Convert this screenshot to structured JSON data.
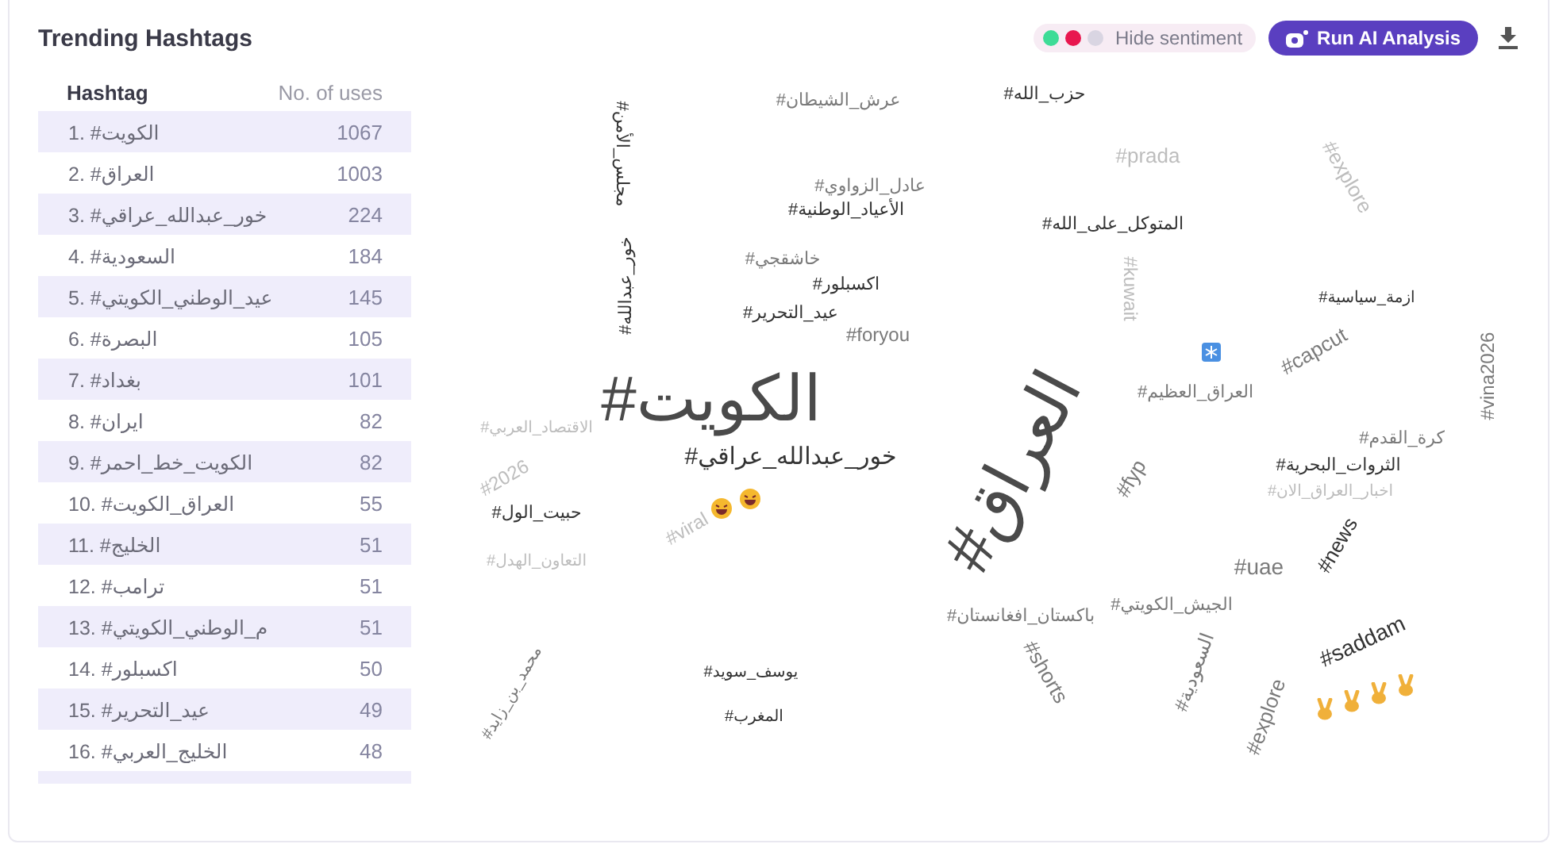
{
  "title": "Trending Hashtags",
  "sentiment": {
    "legend": [
      {
        "color": "#3ddc97"
      },
      {
        "color": "#e8174f"
      },
      {
        "color": "#d9d5e2"
      }
    ],
    "label": "Hide sentiment"
  },
  "ai_button": {
    "label": "Run AI Analysis"
  },
  "table": {
    "headers": {
      "hashtag": "Hashtag",
      "uses": "No. of uses"
    },
    "rows": [
      {
        "hashtag": "1. #الكويت",
        "uses": "1067"
      },
      {
        "hashtag": "2. #العراق",
        "uses": "1003"
      },
      {
        "hashtag": "3. #خور_عبدالله_عراقي",
        "uses": "224"
      },
      {
        "hashtag": "4. #السعودية",
        "uses": "184"
      },
      {
        "hashtag": "5. #عيد_الوطني_الكويتي",
        "uses": "145"
      },
      {
        "hashtag": "6. #البصرة",
        "uses": "105"
      },
      {
        "hashtag": "7. #بغداد",
        "uses": "101"
      },
      {
        "hashtag": "8. #ايران",
        "uses": "82"
      },
      {
        "hashtag": "9. #الكويت_خط_احمر",
        "uses": "82"
      },
      {
        "hashtag": "10. #العراق_الكويت",
        "uses": "55"
      },
      {
        "hashtag": "11. #الخليج",
        "uses": "51"
      },
      {
        "hashtag": "12. #ترامب",
        "uses": "51"
      },
      {
        "hashtag": "13. #م_الوطني_الكويتي",
        "uses": "51"
      },
      {
        "hashtag": "14. #اكسبلور",
        "uses": "50"
      },
      {
        "hashtag": "15. #عيد_التحرير",
        "uses": "49"
      },
      {
        "hashtag": "16. #الخليج_العربي",
        "uses": "48"
      }
    ]
  },
  "cloud": {
    "words": [
      "#حزب_الله",
      "#عرش_الشيطان",
      "#explore",
      "#prada",
      "#عادل_الزواوي",
      "#مجلس_الأمن",
      "#المتوكل_على_الله",
      "#الأعياد_الوطنية",
      "#خاشقجي",
      "#ازمة_سياسية",
      "#kuwait",
      "#اكسبلور",
      "#عيد_التحرير",
      "#خور_عبدالله",
      "#vina2026",
      "#capcut",
      "#العراق_العظيم",
      "#foryou",
      "#الكويت",
      "#كرة_القدم",
      "#العراق",
      "#خور_عبدالله_عراقي",
      "#الاقتصاد_العربي",
      "#الثروات_البحرية",
      "#اخبار_العراق_الان",
      "#fyp",
      "#حبيت_الول",
      "#2026",
      "#news",
      "#uae",
      "#viral",
      "#التعاون_الهدل",
      "#saddam",
      "#الجيش_الكويتي",
      "#باكستان_افغانستان",
      "#السعودية",
      "#shorts",
      "#يوسف_سويد",
      "#محمد_بن_زايد",
      "#explore",
      "#المغرب"
    ]
  }
}
